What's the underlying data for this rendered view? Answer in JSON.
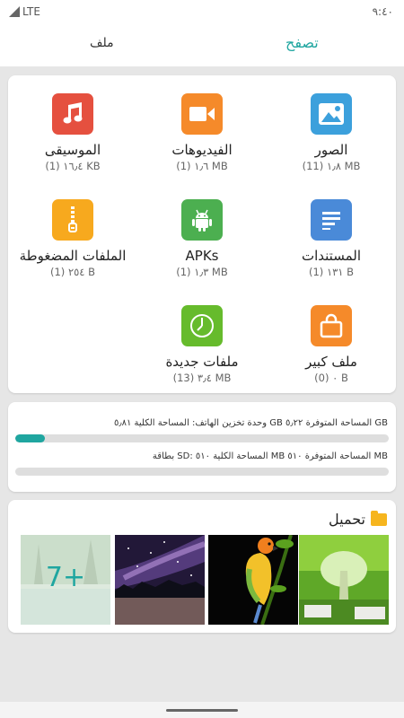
{
  "status_bar": {
    "network": "LTE",
    "time": "٩:٤٠"
  },
  "tabs": {
    "files": "ملف",
    "browse": "تصفح"
  },
  "categories": [
    {
      "name": "الصور",
      "info": "(11) ١٫٨ MB",
      "icon": "image-icon",
      "color": "#3ca0dc"
    },
    {
      "name": "الفيديوهات",
      "info": "(1) ١٫٦ MB",
      "icon": "video-icon",
      "color": "#f58a2a"
    },
    {
      "name": "الموسيقى",
      "info": "(1) ١٦٫٤ KB",
      "icon": "music-icon",
      "color": "#e5503f"
    },
    {
      "name": "المستندات",
      "info": "(1) ١٣١ B",
      "icon": "document-icon",
      "color": "#4a8ad8"
    },
    {
      "name": "APKs",
      "info": "(1) ١٫٣ MB",
      "icon": "android-icon",
      "color": "#4caf50"
    },
    {
      "name": "الملفات المضغوطة",
      "info": "(1) ٢٥٤ B",
      "icon": "zip-icon",
      "color": "#f7a91e"
    },
    {
      "name": "ملف كبير",
      "info": "(0) ٠ B",
      "icon": "bag-icon",
      "color": "#f58a2a"
    },
    {
      "name": "ملفات جديدة",
      "info": "(13) ٣٫٤ MB",
      "icon": "clock-icon",
      "color": "#66bb2c"
    }
  ],
  "storage": {
    "phone_label": "وحدة تخزين الهاتف: المساحة الكلية ٥٫٨١ GB  المساحة المتوفرة ٥٫٢٢ GB",
    "phone_used_fraction": 0.08,
    "sd_label": "بطاقة SD: المساحة الكلية ٥١٠ MB  المساحة المتوفرة ٥١٠ MB",
    "sd_used_fraction": 0.0,
    "accent": "#1fa6a0"
  },
  "downloads": {
    "title": "تحميل",
    "more_count": "7+"
  }
}
